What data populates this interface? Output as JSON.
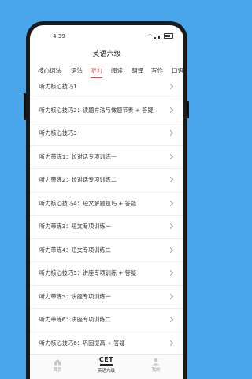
{
  "status": {
    "time": "4:39"
  },
  "header": {
    "title": "英语六级"
  },
  "tabs": [
    "核心词法",
    "语法",
    "听力",
    "阅读",
    "翻译",
    "写作",
    "口语"
  ],
  "active_tab": "听力",
  "list": [
    "听力核心技巧1",
    "听力核心技巧2：读题方法与做题节奏 + 答疑",
    "听力核心技巧3",
    "听力带练1：长对话专项训练一",
    "听力带练2：长对话专项训练二",
    "听力核心技巧4：短文解题技巧 + 答疑",
    "听力带练3：短文专项训练一",
    "听力带练4：短文专项训练二",
    "听力核心技巧5：讲座专项训练 + 答疑",
    "听力带练5：讲座专项训练一",
    "听力带练6：讲座专项训练二",
    "听力核心技巧6：巩固提高 + 答疑"
  ],
  "bottom_nav": {
    "home": "首页",
    "cet_logo": "CET",
    "cet": "英语六级",
    "mine": "我的"
  },
  "colors": {
    "accent": "#e8453c",
    "background": "#4aa6ea"
  }
}
